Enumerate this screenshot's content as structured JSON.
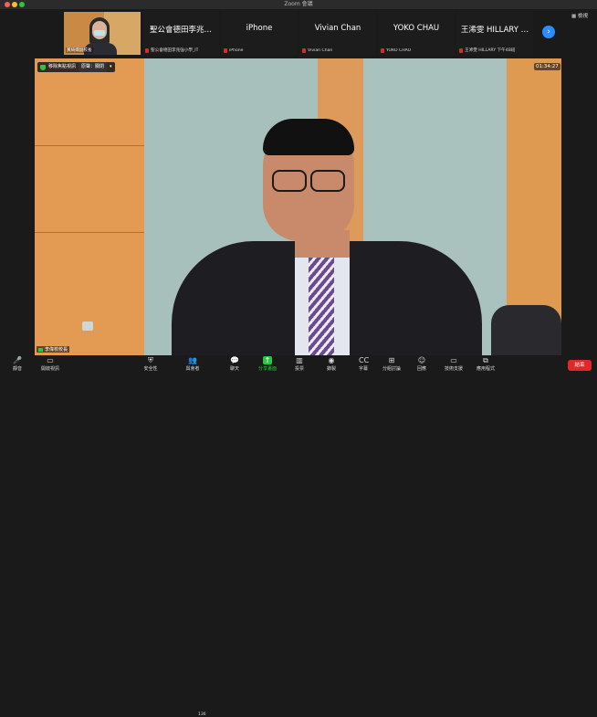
{
  "window": {
    "title": "Zoom 會議"
  },
  "strip": {
    "video_tile": {
      "label": "黃綺嫻副校長"
    },
    "tiles": [
      {
        "name": "聖公會德田李兆…",
        "sub": "聖公會德田李兆強小學_IT"
      },
      {
        "name": "iPhone",
        "sub": "iPhone"
      },
      {
        "name": "Vivian Chan",
        "sub": "Vivian Chan"
      },
      {
        "name": "YOKO CHAU",
        "sub": "YOKO CHAU"
      },
      {
        "name": "王浠雯 HILLARY …",
        "sub": "王浠雯 HILLARY 下午4B班"
      }
    ],
    "next_icon": "›",
    "view_label": "檢視"
  },
  "main": {
    "security_label": "移除焦點視訊",
    "focus_label": "原聲：關閉",
    "timer": "01:34:27",
    "speaker_name": "李偉校校長"
  },
  "toolbar": {
    "items": [
      {
        "label": "靜音",
        "icon": "🎤"
      },
      {
        "label": "開啟視訊",
        "icon": "▭"
      },
      {
        "label": "安全性",
        "icon": "⛨"
      },
      {
        "label": "與會者",
        "icon": "👥"
      },
      {
        "label": "聊天",
        "icon": "💬"
      },
      {
        "label": "分享畫面",
        "icon": "↑"
      },
      {
        "label": "投票",
        "icon": "▥"
      },
      {
        "label": "錄製",
        "icon": "◉"
      },
      {
        "label": "字幕",
        "icon": "CC"
      },
      {
        "label": "分組討論",
        "icon": "⊞"
      },
      {
        "label": "回應",
        "icon": "☺"
      },
      {
        "label": "技術支援",
        "icon": "▭"
      },
      {
        "label": "應用程式",
        "icon": "⧉"
      }
    ],
    "participant_count": "136",
    "end_label": "結束"
  }
}
